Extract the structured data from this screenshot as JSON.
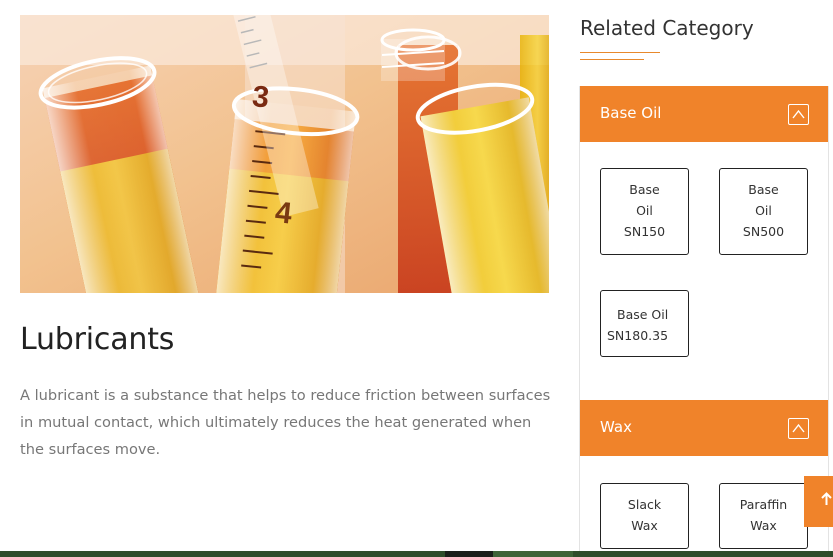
{
  "article": {
    "title": "Lubricants",
    "description": "A lubricant is a substance that helps to reduce friction between surfaces in mutual contact, which ultimately reduces the heat generated when the surfaces move.",
    "image_numbers": [
      "3",
      "4"
    ]
  },
  "sidebar": {
    "title": "Related Category",
    "panels": [
      {
        "label": "Base Oil",
        "items": [
          {
            "lines": [
              "Base",
              "Oil",
              "SN150"
            ]
          },
          {
            "lines": [
              "Base",
              "Oil",
              "SN500"
            ]
          },
          {
            "lines": [
              "Base Oil",
              "SN180.35"
            ]
          }
        ]
      },
      {
        "label": "Wax",
        "items": [
          {
            "lines": [
              "Slack",
              "Wax"
            ]
          },
          {
            "lines": [
              "Paraffin",
              "Wax"
            ]
          }
        ]
      }
    ]
  },
  "colors": {
    "accent": "#f0832a",
    "title": "#222222",
    "body_text": "#777777",
    "footer": "#2f4d2b"
  },
  "icons": {
    "toggle": "chevron-up-icon",
    "scroll_top": "arrow-up-icon"
  }
}
